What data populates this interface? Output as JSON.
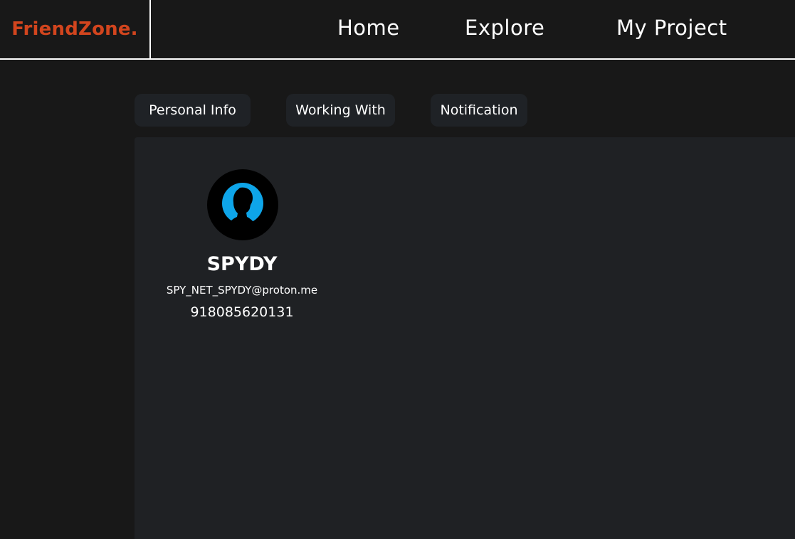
{
  "brand": {
    "logo_text": "FriendZone.",
    "accent_color": "#d2451e"
  },
  "nav": {
    "items": [
      {
        "label": "Home"
      },
      {
        "label": "Explore"
      },
      {
        "label": "My Project"
      }
    ]
  },
  "tabs": [
    {
      "label": "Personal Info"
    },
    {
      "label": "Working With"
    },
    {
      "label": "Notification"
    }
  ],
  "profile": {
    "avatar_icon": "user-silhouette-icon",
    "avatar_color": "#0ea5e9",
    "name": "SPYDY",
    "email": "SPY_NET_SPYDY@proton.me",
    "phone": "918085620131"
  }
}
